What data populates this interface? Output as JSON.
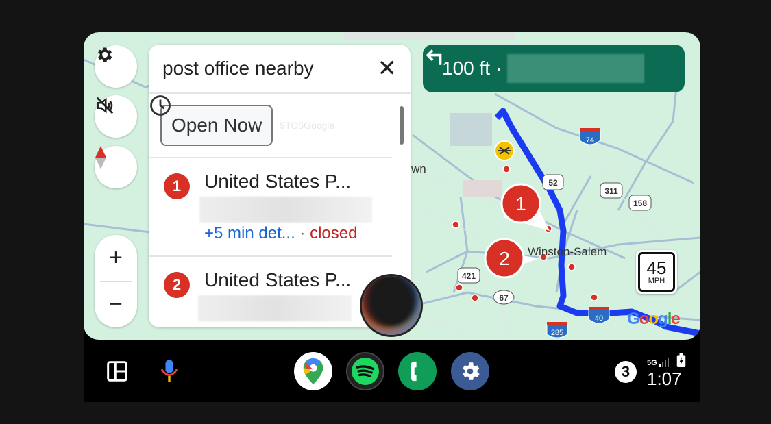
{
  "search": {
    "query": "post office nearby",
    "close_icon": "close-icon"
  },
  "filter": {
    "open_now_label": "Open Now",
    "watermark": "9TO5Google"
  },
  "results": [
    {
      "number": "1",
      "name": "United States P...",
      "detour": "+5 min det...",
      "separator": "·",
      "status": "closed"
    },
    {
      "number": "2",
      "name": "United States P...",
      "detour": "",
      "separator": "",
      "status": ""
    }
  ],
  "nav": {
    "distance": "100 ft ·",
    "turn_icon": "turn-left-icon"
  },
  "map": {
    "city_label": "Winston-Salem",
    "partial_label": "wn",
    "markers": [
      "1",
      "2"
    ],
    "highway_shields": [
      "74",
      "52",
      "311",
      "158",
      "421",
      "67",
      "40",
      "285"
    ],
    "speed_limit": {
      "value": "45",
      "unit": "MPH"
    },
    "logo": "Google",
    "route_color": "#1a3bf0",
    "land_color": "#d4f1e0"
  },
  "controls": {
    "zoom_in": "+",
    "zoom_out": "−"
  },
  "taskbar": {
    "apps": [
      "Google Maps",
      "Spotify",
      "Phone",
      "Settings"
    ],
    "notification_count": "3",
    "network": "5G",
    "time": "1:07"
  }
}
